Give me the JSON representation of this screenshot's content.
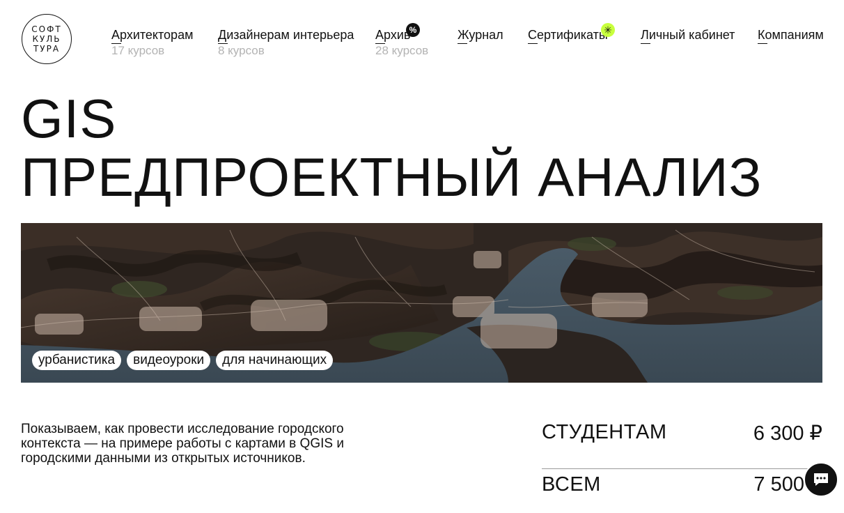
{
  "logo": {
    "lines": [
      "СОФТ",
      "КУЛЬ",
      "ТУРА"
    ]
  },
  "nav": {
    "architects": {
      "label": "Архитекторам",
      "sub": "17 курсов"
    },
    "designers": {
      "label": "Дизайнерам интерьера",
      "sub": "8 курсов"
    },
    "archive": {
      "label": "Архив",
      "sub": "28 курсов",
      "badge": "%"
    },
    "journal": {
      "label": "Журнал"
    },
    "certificates": {
      "label": "Сертификаты",
      "badge": "✳"
    },
    "cabinet": {
      "label": "Личный кабинет"
    },
    "companies": {
      "label": "Компаниям"
    }
  },
  "course": {
    "title_line1": "GIS",
    "title_line2": "ПРЕДПРОЕКТНЫЙ АНАЛИЗ",
    "tags": [
      "урбанистика",
      "видеоуроки",
      "для начинающих"
    ],
    "description": "Показываем, как провести исследование городского контекста — на примере работы с картами в QGIS и городскими данными из открытых источников."
  },
  "prices": [
    {
      "label": "СТУДЕНТАМ",
      "value": "6 300 ₽"
    },
    {
      "label": "ВСЕМ",
      "value": "7 500"
    }
  ],
  "colors": {
    "accent_badge": "#c8ff3d",
    "text": "#111111",
    "muted": "#b3b3b3"
  },
  "icons": {
    "chat": "chat-bubble-icon"
  }
}
